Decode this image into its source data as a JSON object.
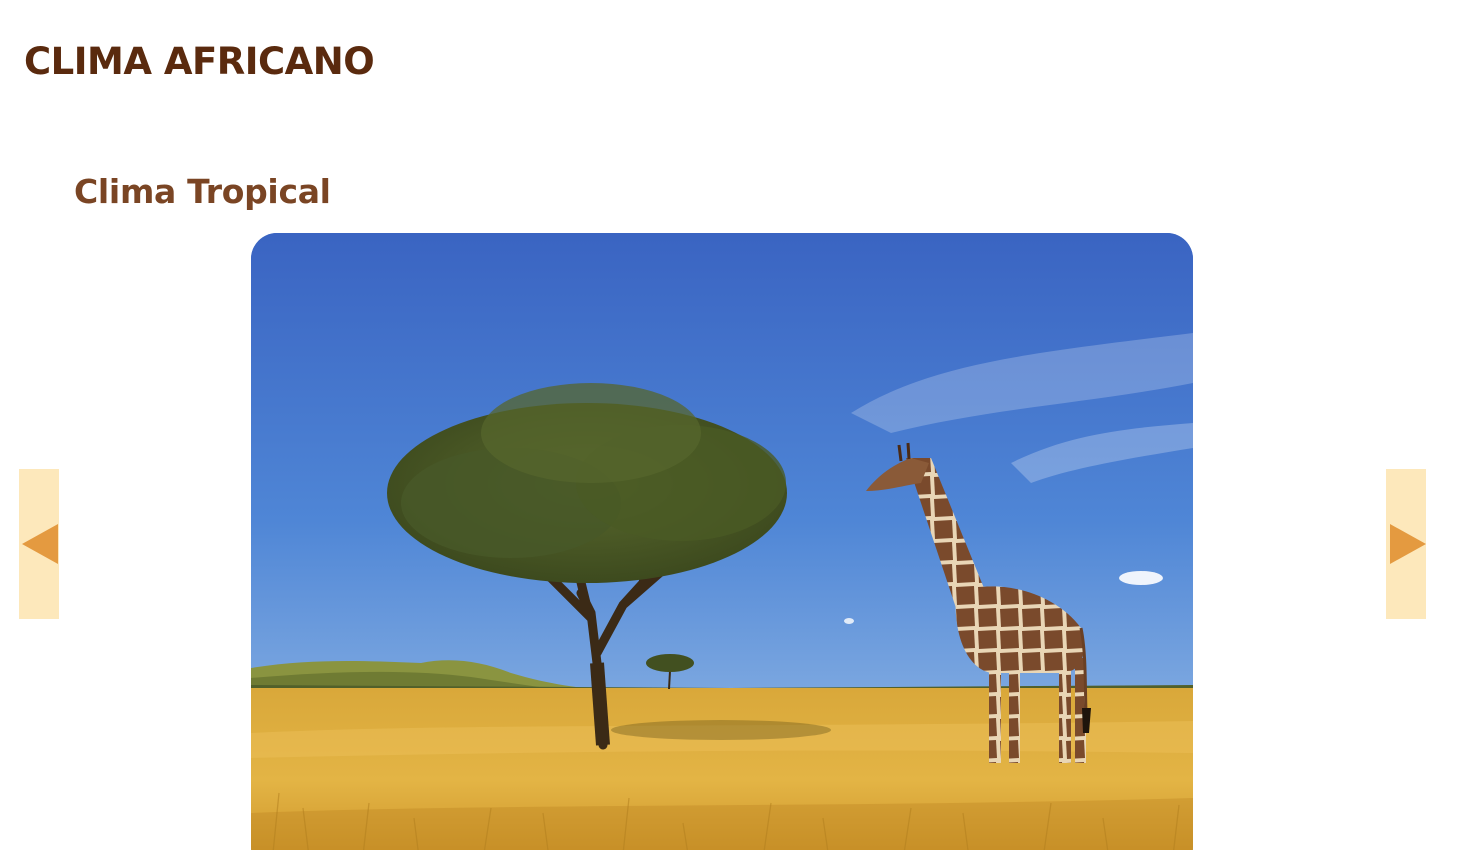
{
  "header": {
    "title": "CLIMA AFRICANO"
  },
  "section": {
    "title": "Clima Tropical"
  },
  "carousel": {
    "image_subject": "savanna-acacia-giraffe",
    "prev_icon": "triangle-left-icon",
    "next_icon": "triangle-right-icon",
    "colors": {
      "button_bg": "#fde8bb",
      "arrow": "#e49a40",
      "title": "#5a2a0e",
      "subtitle": "#7a4524"
    }
  }
}
